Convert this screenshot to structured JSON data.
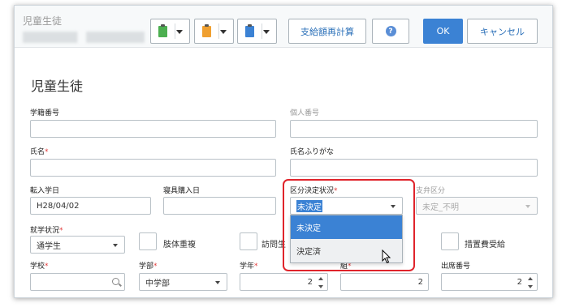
{
  "window": {
    "title": "児童生徒",
    "subtitle_redacted": true
  },
  "toolbar": {
    "doc_buttons": [
      {
        "icon": "clipboard-green-icon",
        "color": "#4caf50"
      },
      {
        "icon": "clipboard-orange-icon",
        "color": "#f0a030"
      },
      {
        "icon": "clipboard-blue-icon",
        "color": "#3b82d4"
      }
    ],
    "recalc_label": "支給額再計算",
    "help_icon": "?",
    "ok_label": "OK",
    "cancel_label": "キャンセル"
  },
  "form": {
    "title": "児童生徒",
    "student_no_label": "学籍番号",
    "personal_no_label": "個人番号",
    "name_label": "氏名",
    "name_kana_label": "氏名ふりがな",
    "transfer_date_label": "転入学日",
    "bedding_date_label": "寝具購入日",
    "transfer_date_value": "H28/04/02",
    "status_label": "区分決定状況",
    "status_value": "未決定",
    "status_options": [
      "未決定",
      "決定済"
    ],
    "payment_label": "支弁区分",
    "payment_value": "未定_不明",
    "enroll_label": "就学状況",
    "enroll_value": "通学生",
    "limb_label": "肢体重複",
    "visit_label": "訪問生",
    "measure_label": "措置費受給",
    "school_label": "学校",
    "dept_label": "学部",
    "dept_value": "中学部",
    "grade_label": "学年",
    "grade_value": "2",
    "class_label": "組",
    "class_value": "2",
    "attendance_label": "出席番号",
    "attendance_value": "2",
    "required_mark": "*"
  },
  "colors": {
    "accent": "#3b82d4",
    "required": "#e23b3b",
    "highlight": "#e0242b"
  }
}
